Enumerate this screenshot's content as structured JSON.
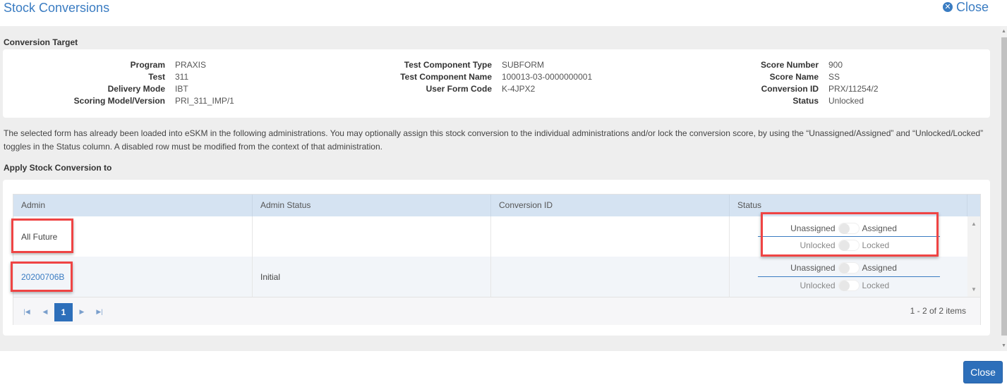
{
  "window": {
    "title": "Stock Conversions",
    "close_link_label": "Close",
    "close_icon": "times-circle-icon"
  },
  "conversion_target": {
    "heading": "Conversion Target",
    "column1": [
      {
        "label": "Program",
        "value": "PRAXIS"
      },
      {
        "label": "Test",
        "value": "311"
      },
      {
        "label": "Delivery Mode",
        "value": "IBT"
      },
      {
        "label": "Scoring Model/Version",
        "value": "PRI_311_IMP/1"
      }
    ],
    "column2": [
      {
        "label": "Test Component Type",
        "value": "SUBFORM"
      },
      {
        "label": "Test Component Name",
        "value": "100013-03-0000000001"
      },
      {
        "label": "User Form Code",
        "value": "K-4JPX2"
      }
    ],
    "column3": [
      {
        "label": "Score Number",
        "value": "900"
      },
      {
        "label": "Score Name",
        "value": "SS"
      },
      {
        "label": "Conversion ID",
        "value": "PRX/11254/2"
      },
      {
        "label": "Status",
        "value": "Unlocked"
      }
    ]
  },
  "description": "The selected form has already been loaded into eSKM in the following administrations. You may optionally assign this stock conversion to the individual administrations and/or lock the conversion score, by using the “Unassigned/Assigned” and “Unlocked/Locked” toggles in the Status column. A disabled row must be modified from the context of that administration.",
  "apply_section": {
    "heading": "Apply Stock Conversion to",
    "columns": [
      "Admin",
      "Admin Status",
      "Conversion ID",
      "Status"
    ],
    "rows": [
      {
        "admin": "All Future",
        "admin_is_link": false,
        "admin_status": "",
        "conversion_id": "",
        "assign_toggle": {
          "off_label": "Unassigned",
          "on_label": "Assigned",
          "on": false
        },
        "lock_toggle": {
          "off_label": "Unlocked",
          "on_label": "Locked",
          "on": false
        }
      },
      {
        "admin": "20200706B",
        "admin_is_link": true,
        "admin_status": "Initial",
        "conversion_id": "",
        "assign_toggle": {
          "off_label": "Unassigned",
          "on_label": "Assigned",
          "on": false
        },
        "lock_toggle": {
          "off_label": "Unlocked",
          "on_label": "Locked",
          "on": false
        }
      }
    ],
    "pager": {
      "current_page": "1",
      "info": "1 - 2 of 2 items",
      "first_icon": "first-page-icon",
      "prev_icon": "prev-page-icon",
      "next_icon": "next-page-icon",
      "last_icon": "last-page-icon"
    }
  },
  "footer": {
    "close_button_label": "Close"
  },
  "colors": {
    "accent": "#3a7cc2",
    "primary_button": "#2d6fba",
    "grid_header": "#d5e3f2",
    "highlight_box": "#ef4444",
    "body_bg": "#eeeeee"
  }
}
